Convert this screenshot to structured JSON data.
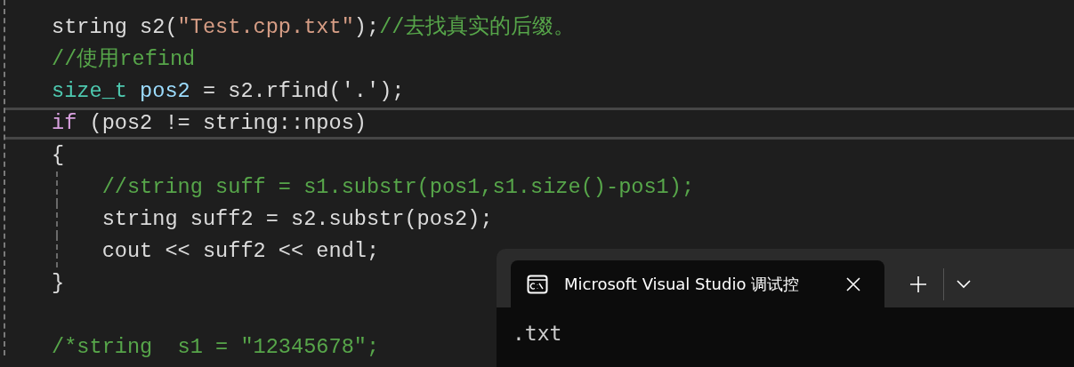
{
  "editor": {
    "lines": [
      {
        "tokens": [
          {
            "text": "string s2(",
            "kind": "plain"
          },
          {
            "text": "\"Test.cpp.txt\"",
            "kind": "string"
          },
          {
            "text": ");",
            "kind": "plain"
          },
          {
            "text": "//去找真实的后缀。",
            "kind": "comment"
          }
        ]
      },
      {
        "tokens": [
          {
            "text": "//使用refind",
            "kind": "comment"
          }
        ]
      },
      {
        "tokens": [
          {
            "text": "size_t",
            "kind": "type"
          },
          {
            "text": " pos2",
            "kind": "variable"
          },
          {
            "text": " = s2.rfind('.');",
            "kind": "plain"
          }
        ]
      },
      {
        "current": true,
        "tokens": [
          {
            "text": "if",
            "kind": "keyword"
          },
          {
            "text": " (pos2 != string::npos)",
            "kind": "plain"
          }
        ]
      },
      {
        "tokens": [
          {
            "text": "{",
            "kind": "plain"
          }
        ]
      },
      {
        "indent_guide": true,
        "tokens": [
          {
            "text": "    //string suff = s1.substr(pos1,s1.size()-pos1);",
            "kind": "comment"
          }
        ]
      },
      {
        "indent_guide": true,
        "tokens": [
          {
            "text": "    string suff2 = s2.substr(pos2);",
            "kind": "plain"
          }
        ]
      },
      {
        "indent_guide": true,
        "tokens": [
          {
            "text": "    cout << suff2 << endl;",
            "kind": "plain"
          }
        ]
      },
      {
        "tokens": [
          {
            "text": "}",
            "kind": "plain"
          }
        ]
      },
      {
        "kind": "blank"
      },
      {
        "tokens": [
          {
            "text": "/*string  s1 = \"12345678\";",
            "kind": "comment"
          }
        ]
      }
    ]
  },
  "terminal": {
    "tab_title": "Microsoft Visual Studio 调试控",
    "output": ".txt"
  }
}
